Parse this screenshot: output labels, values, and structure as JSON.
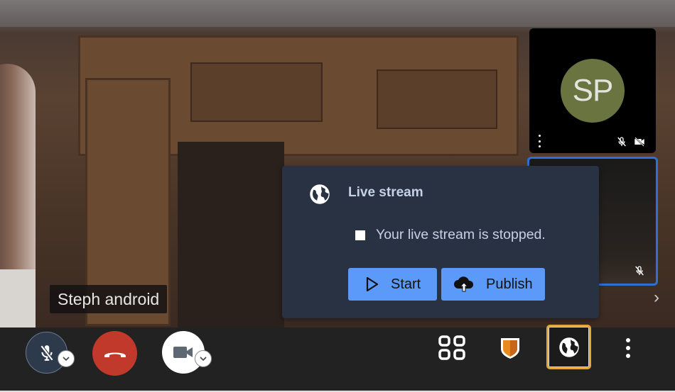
{
  "main_video": {
    "participant_name": "Steph android"
  },
  "tiles": [
    {
      "initials": "SP",
      "avatar_color": "#6a7441",
      "muted": true,
      "video_off": true
    },
    {
      "self_view": true,
      "muted": true,
      "active_border_color": "#2f6fd6"
    }
  ],
  "live_stream_popup": {
    "title": "Live stream",
    "status_text": "Your live stream is stopped.",
    "start_label": "Start",
    "publish_label": "Publish",
    "button_color": "#5b9af8"
  },
  "toolbar": {
    "mic": {
      "state": "muted"
    },
    "hangup": {
      "color": "#c0392b"
    },
    "camera": {
      "state": "on"
    },
    "tile_view": "grid-icon",
    "security": "shield-icon",
    "live_stream": {
      "active": true,
      "highlight_color": "#e3a63a"
    },
    "more": "more-icon"
  }
}
